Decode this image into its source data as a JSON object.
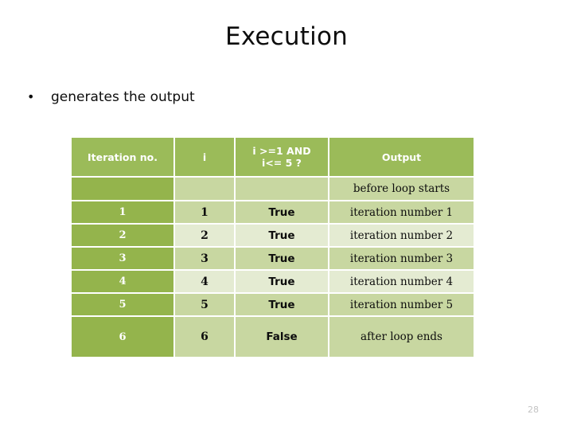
{
  "slide": {
    "title": "Execution",
    "page_number": "28",
    "bullet_marker": "•",
    "bullet_text": "generates the output"
  },
  "colors": {
    "header_green": "#9BBB59",
    "first_col_green": "#94B44C",
    "band_dark": "#C8D7A1",
    "band_light": "#E4EBD2",
    "header_text": "#FFFFFF",
    "body_text": "#0D0D0D",
    "page_number_text": "#C3C3C3",
    "background": "#FFFFFF"
  },
  "table": {
    "headers": [
      "Iteration no.",
      "i",
      "i >=1 AND",
      "i<= 5 ?",
      "Output"
    ],
    "header_cond_line1": "i >=1 AND",
    "header_cond_line2": "i<= 5 ?",
    "rows": [
      {
        "iteration": "",
        "i": "",
        "condition": "",
        "output": "before loop starts"
      },
      {
        "iteration": "1",
        "i": "1",
        "condition": "True",
        "output": "iteration number 1"
      },
      {
        "iteration": "2",
        "i": "2",
        "condition": "True",
        "output": "iteration number 2"
      },
      {
        "iteration": "3",
        "i": "3",
        "condition": "True",
        "output": "iteration number 3"
      },
      {
        "iteration": "4",
        "i": "4",
        "condition": "True",
        "output": "iteration number 4"
      },
      {
        "iteration": "5",
        "i": "5",
        "condition": "True",
        "output": "iteration number 5"
      },
      {
        "iteration": "6",
        "i": "6",
        "condition": "False",
        "output": "after loop ends"
      }
    ]
  }
}
